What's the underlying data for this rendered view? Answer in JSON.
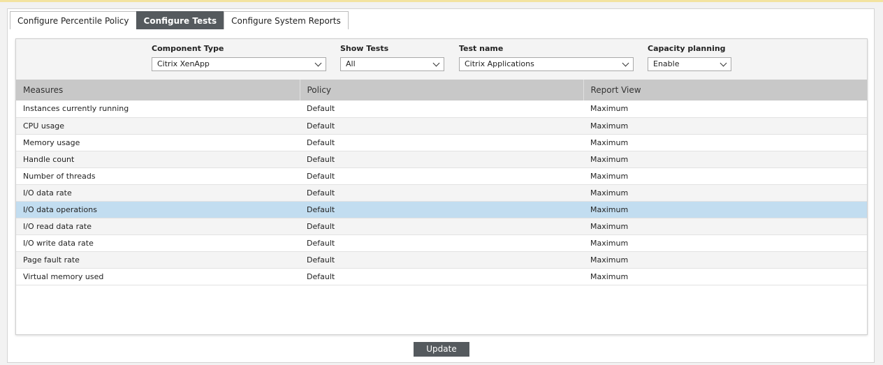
{
  "tabs": [
    {
      "label": "Configure Percentile Policy",
      "active": false
    },
    {
      "label": "Configure Tests",
      "active": true
    },
    {
      "label": "Configure System Reports",
      "active": false
    }
  ],
  "filters": {
    "component_type": {
      "label": "Component Type",
      "value": "Citrix XenApp"
    },
    "show_tests": {
      "label": "Show Tests",
      "value": "All"
    },
    "test_name": {
      "label": "Test name",
      "value": "Citrix Applications"
    },
    "capacity_planning": {
      "label": "Capacity planning",
      "value": "Enable"
    }
  },
  "table": {
    "headers": [
      "Measures",
      "Policy",
      "Report View"
    ],
    "rows": [
      {
        "measure": "Instances currently running",
        "policy": "Default",
        "report_view": "Maximum"
      },
      {
        "measure": "CPU usage",
        "policy": "Default",
        "report_view": "Maximum"
      },
      {
        "measure": "Memory usage",
        "policy": "Default",
        "report_view": "Maximum"
      },
      {
        "measure": "Handle count",
        "policy": "Default",
        "report_view": "Maximum"
      },
      {
        "measure": "Number of threads",
        "policy": "Default",
        "report_view": "Maximum"
      },
      {
        "measure": "I/O data rate",
        "policy": "Default",
        "report_view": "Maximum"
      },
      {
        "measure": "I/O data operations",
        "policy": "Default",
        "report_view": "Maximum",
        "selected": true
      },
      {
        "measure": "I/O read data rate",
        "policy": "Default",
        "report_view": "Maximum"
      },
      {
        "measure": "I/O write data rate",
        "policy": "Default",
        "report_view": "Maximum"
      },
      {
        "measure": "Page fault rate",
        "policy": "Default",
        "report_view": "Maximum"
      },
      {
        "measure": "Virtual memory used",
        "policy": "Default",
        "report_view": "Maximum"
      }
    ]
  },
  "update_label": "Update",
  "colors": {
    "tab_active_bg": "#555a5e",
    "header_bg": "#c8c8c8",
    "selected_row_bg": "#c2ddf0",
    "button_bg": "#555a5e"
  }
}
